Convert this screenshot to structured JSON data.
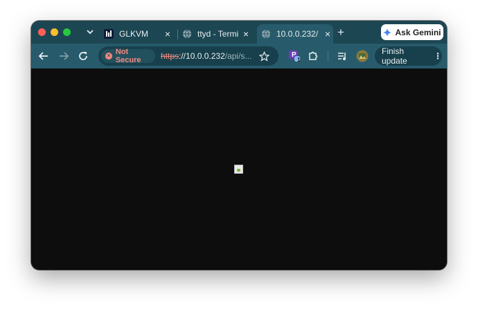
{
  "tabs": [
    {
      "title": "GLKVM",
      "favicon": "glkvm-logo-icon",
      "close": "×"
    },
    {
      "title": "ttyd - Termi",
      "favicon": "globe-icon",
      "close": "×"
    },
    {
      "title": "10.0.0.232/",
      "favicon": "globe-icon",
      "close": "×",
      "active": true
    }
  ],
  "new_tab_label": "+",
  "ask_gemini_label": "Ask Gemini",
  "security_chip_label": "Not Secure",
  "url": {
    "scheme": "https",
    "host": "://10.0.0.232",
    "path": "/api/s..."
  },
  "extension_badge": "1",
  "extension_letter": "P",
  "finish_update_label": "Finish update",
  "colors": {
    "tabstrip": "#1d4653",
    "toolbar": "#275b6b",
    "omnibox": "#17404c",
    "warning": "#f28b82",
    "page_background": "#0d0d0d"
  }
}
